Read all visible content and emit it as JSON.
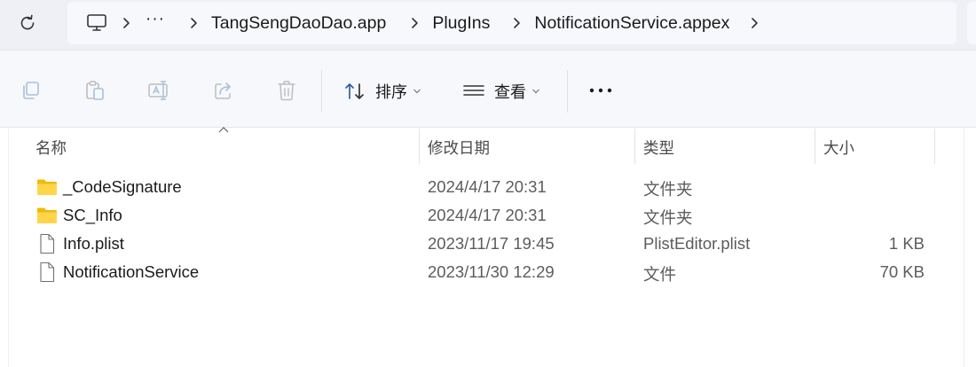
{
  "address_bar": {
    "more_label": "···",
    "crumbs": [
      "TangSengDaoDao.app",
      "PlugIns",
      "NotificationService.appex"
    ]
  },
  "toolbar": {
    "sort_label": "排序",
    "view_label": "查看",
    "more_label": "···"
  },
  "columns": {
    "name": "名称",
    "date": "修改日期",
    "type": "类型",
    "size": "大小"
  },
  "files": [
    {
      "name": "_CodeSignature",
      "date": "2024/4/17 20:31",
      "type": "文件夹",
      "size": "",
      "icon": "folder-icon"
    },
    {
      "name": "SC_Info",
      "date": "2024/4/17 20:31",
      "type": "文件夹",
      "size": "",
      "icon": "folder-icon"
    },
    {
      "name": "Info.plist",
      "date": "2023/11/17 19:45",
      "type": "PlistEditor.plist",
      "size": "1 KB",
      "icon": "file-icon"
    },
    {
      "name": "NotificationService",
      "date": "2023/11/30 12:29",
      "type": "文件",
      "size": "70 KB",
      "icon": "file-icon"
    }
  ],
  "colors": {
    "folder": "#f5c518",
    "toolbar_bg": "#f7f8fb",
    "address_bg": "#eef0f5"
  }
}
